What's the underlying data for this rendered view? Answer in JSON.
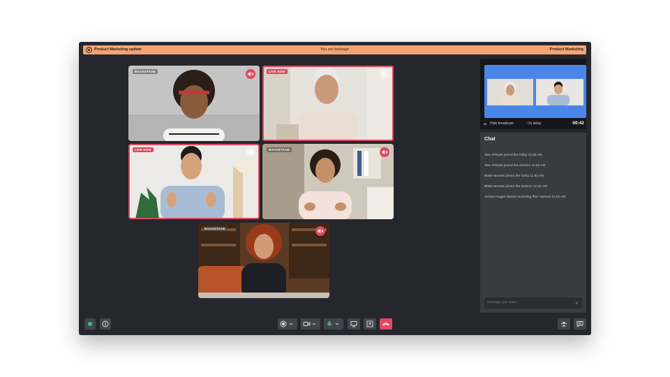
{
  "header": {
    "meeting_title": "Product Marketing update",
    "status": "You are backage",
    "channel": "Product Marketing"
  },
  "tiles": [
    {
      "tag": "BACKSTAGE",
      "audio": "muted"
    },
    {
      "tag": "LIVE NOW",
      "audio": "on"
    },
    {
      "tag": "LIVE NOW",
      "audio": "on"
    },
    {
      "tag": "BACKSTAGE",
      "audio": "muted"
    },
    {
      "tag": "BACKSTAGE",
      "audio": "muted"
    }
  ],
  "broadcast": {
    "hide_label": "Hide broadcast",
    "delay": "~3s delay",
    "timer": "00:42"
  },
  "chat": {
    "title": "Chat",
    "messages": [
      "Alex O'Ryan joined the lobby 11:52 AM",
      "Alex O'Ryan joined the session 11:52 AM",
      "Blake Montes joined the lobby 11:53 AM",
      "Blake Montes joined the session 11:52 AM",
      "Jordan Hugps started recording their camera 11:54 AM"
    ],
    "input_placeholder": "Message your team"
  },
  "colors": {
    "accent": "#f4a373",
    "live": "#e0485f",
    "background": "#25262e",
    "panel": "#393a42",
    "broadcast_screen": "#4a86e8",
    "status_green": "#3ec46d"
  },
  "toolbar": {
    "left": [
      "status-dot-icon",
      "info-icon"
    ],
    "center": [
      "record-icon",
      "camera-icon",
      "microphone-icon",
      "screen-share-icon",
      "share-icon",
      "end-call-icon"
    ],
    "right": [
      "participants-icon",
      "chat-icon"
    ]
  }
}
